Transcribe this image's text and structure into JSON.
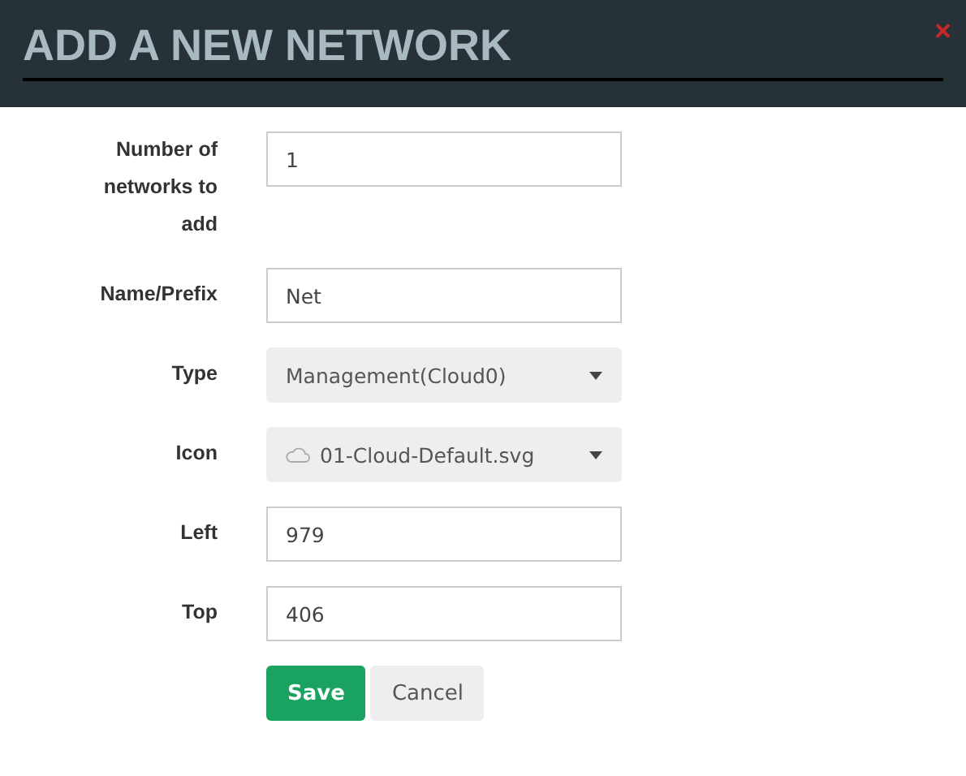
{
  "dialog": {
    "title": "ADD A NEW NETWORK",
    "close": "×"
  },
  "fields": [
    {
      "kind": "text",
      "label": "Number of networks to add",
      "value": "1"
    },
    {
      "kind": "text",
      "label": "Name/Prefix",
      "value": "Net"
    },
    {
      "kind": "select",
      "label": "Type",
      "value": "Management(Cloud0)"
    },
    {
      "kind": "icon-select",
      "label": "Icon",
      "value": "01-Cloud-Default.svg"
    },
    {
      "kind": "text",
      "label": "Left",
      "value": "979"
    },
    {
      "kind": "text",
      "label": "Top",
      "value": "406"
    }
  ],
  "buttons": [
    {
      "kind": "primary",
      "label": "Save"
    },
    {
      "kind": "secondary",
      "label": "Cancel"
    }
  ]
}
